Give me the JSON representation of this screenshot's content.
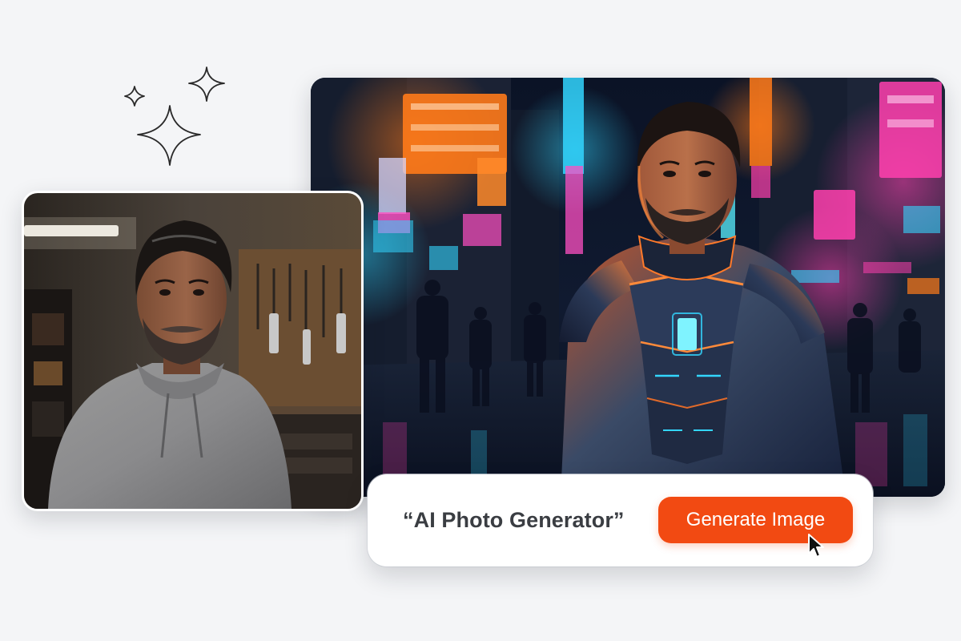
{
  "prompt": {
    "text": "“AI Photo Generator”"
  },
  "generate_button": {
    "label": "Generate Image",
    "color": "#f24a12"
  },
  "colors": {
    "background": "#f4f5f7",
    "accent": "#f24a12",
    "neon_pink": "#ff3fae",
    "neon_cyan": "#33d6ff",
    "neon_orange": "#ff7a1a"
  },
  "icons": {
    "sparkles": "sparkles-icon",
    "cursor": "mouse-pointer-icon"
  }
}
